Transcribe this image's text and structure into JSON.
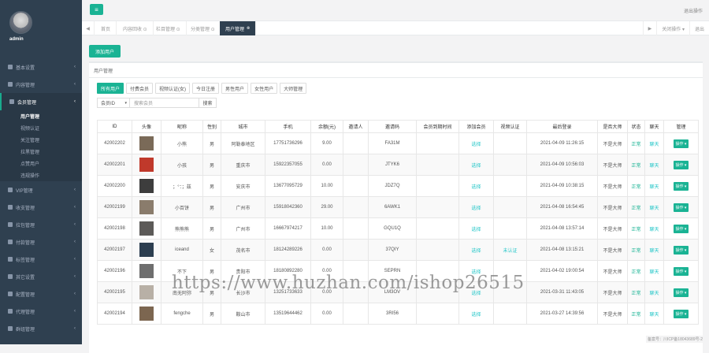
{
  "profile": {
    "username": "admin"
  },
  "sidebar": {
    "items": [
      {
        "label": "基本设置",
        "icon": "gear-icon"
      },
      {
        "label": "内容管理",
        "icon": "edit-icon"
      },
      {
        "label": "会员管理",
        "icon": "user-icon",
        "active": true
      },
      {
        "label": "VIP管理",
        "icon": "vip-icon"
      },
      {
        "label": "收支管理",
        "icon": "wallet-icon"
      },
      {
        "label": "拉包管理",
        "icon": "bag-icon"
      },
      {
        "label": "付款管理",
        "icon": "card-icon"
      },
      {
        "label": "标签管理",
        "icon": "tag-icon"
      },
      {
        "label": "其它设置",
        "icon": "list-icon"
      },
      {
        "label": "配置管理",
        "icon": "wrench-icon"
      },
      {
        "label": "代理管理",
        "icon": "agent-icon"
      },
      {
        "label": "群组管理",
        "icon": "group-icon"
      }
    ],
    "subitems": [
      "用户管理",
      "视频认证",
      "关注管理",
      "拉黑管理",
      "点赞用户",
      "违规操作"
    ]
  },
  "topbar": {
    "menu_icon": "≡",
    "logout": "退出操作"
  },
  "tabs": {
    "back": "◀",
    "items": [
      "首页",
      "内容回收 ⊙",
      "栏目管理 ⊙",
      "分类管理 ⊙"
    ],
    "active": "用户管理",
    "forward": "▶",
    "close_ops": "关闭操作 ▾",
    "exit": "退出"
  },
  "content": {
    "add_user": "添加用户",
    "panel_title": "用户管理",
    "filters": [
      "所有用户",
      "付费会员",
      "视频认证(女)",
      "今日注册",
      "男性用户",
      "女性用户",
      "大师管理"
    ],
    "search": {
      "type": "会员ID",
      "placeholder": "搜索会员",
      "button": "搜索"
    },
    "table": {
      "headers": [
        "ID",
        "头像",
        "昵称",
        "性别",
        "城市",
        "手机",
        "余额(元)",
        "邀请人",
        "邀请码",
        "会员到期时间",
        "添加会员",
        "视频认证",
        "最后登录",
        "是否大师",
        "状态",
        "聊天",
        "管理"
      ],
      "rows": [
        {
          "id": "42002202",
          "nick": "小熊",
          "sex": "男",
          "city": "阿勒泰地区",
          "phone": "17751736296",
          "balance": "9.00",
          "inviter": "",
          "code": "FA31M",
          "expire": "",
          "add": "选择",
          "video": "",
          "last": "2021-04-09 11:26:15",
          "master": "不是大师",
          "status": "正常",
          "chat": "聊天",
          "op": "操作 ▾"
        },
        {
          "id": "42002201",
          "nick": "小孩",
          "sex": "男",
          "city": "重庆市",
          "phone": "15922357055",
          "balance": "0.00",
          "inviter": "",
          "code": "JTYK6",
          "expire": "",
          "add": "选择",
          "video": "",
          "last": "2021-04-09 10:56:03",
          "master": "不是大师",
          "status": "正常",
          "chat": "聊天",
          "op": "操作 ▾"
        },
        {
          "id": "42002200",
          "nick": "；°：；兹",
          "sex": "男",
          "city": "安庆市",
          "phone": "13677095729",
          "balance": "10.00",
          "inviter": "",
          "code": "JDZ7Q",
          "expire": "",
          "add": "选择",
          "video": "",
          "last": "2021-04-09 10:38:15",
          "master": "不是大师",
          "status": "正常",
          "chat": "聊天",
          "op": "操作 ▾"
        },
        {
          "id": "42002199",
          "nick": "小百饼",
          "sex": "男",
          "city": "广州市",
          "phone": "15918042360",
          "balance": "29.00",
          "inviter": "",
          "code": "6AWK1",
          "expire": "",
          "add": "选择",
          "video": "",
          "last": "2021-04-08 16:54:45",
          "master": "不是大师",
          "status": "正常",
          "chat": "聊天",
          "op": "操作 ▾"
        },
        {
          "id": "42002198",
          "nick": "熊熊熊",
          "sex": "男",
          "city": "广州市",
          "phone": "16667974217",
          "balance": "10.00",
          "inviter": "",
          "code": "GQU1Q",
          "expire": "",
          "add": "选择",
          "video": "",
          "last": "2021-04-08 13:57:14",
          "master": "不是大师",
          "status": "正常",
          "chat": "聊天",
          "op": "操作 ▾"
        },
        {
          "id": "42002197",
          "nick": "iceand",
          "sex": "女",
          "city": "茂名市",
          "phone": "18124289226",
          "balance": "0.00",
          "inviter": "",
          "code": "37QIY",
          "expire": "",
          "add": "选择",
          "video": "未认证",
          "last": "2021-04-08 13:15:21",
          "master": "不是大师",
          "status": "正常",
          "chat": "聊天",
          "op": "操作 ▾"
        },
        {
          "id": "42002196",
          "nick": "不下",
          "sex": "男",
          "city": "贵阳市",
          "phone": "18180892280",
          "balance": "0.00",
          "inviter": "",
          "code": "SEPRN",
          "expire": "",
          "add": "选择",
          "video": "",
          "last": "2021-04-02 19:00:54",
          "master": "不是大师",
          "status": "正常",
          "chat": "聊天",
          "op": "操作 ▾"
        },
        {
          "id": "42002195",
          "nick": "南无阿弥",
          "sex": "男",
          "city": "长沙市",
          "phone": "13251733633",
          "balance": "0.00",
          "inviter": "",
          "code": "LM3OV",
          "expire": "",
          "add": "选择",
          "video": "",
          "last": "2021-03-31 11:43:05",
          "master": "不是大师",
          "status": "正常",
          "chat": "聊天",
          "op": "操作 ▾"
        },
        {
          "id": "42002194",
          "nick": "fengche",
          "sex": "男",
          "city": "鞍山市",
          "phone": "13519644462",
          "balance": "0.00",
          "inviter": "",
          "code": "3RI56",
          "expire": "",
          "add": "选择",
          "video": "",
          "last": "2021-03-27 14:39:56",
          "master": "不是大师",
          "status": "正常",
          "chat": "聊天",
          "op": "操作 ▾"
        }
      ]
    }
  },
  "icp": "备案号：川ICP备18043689号-2",
  "watermark": "https://www.huzhan.com/ishop26515",
  "thumb_colors": [
    "#7a6a58",
    "#c0392b",
    "#3d3d3d",
    "#8a7c6c",
    "#5c5a58",
    "#2c3e50",
    "#6e6e6e",
    "#b8b0a6",
    "#7c6650"
  ]
}
